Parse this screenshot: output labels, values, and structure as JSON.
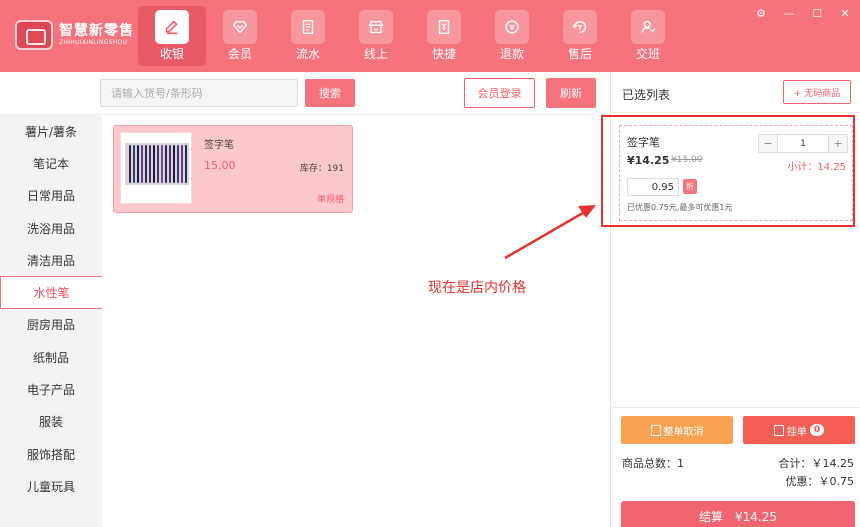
{
  "app": {
    "logo_cn": "智慧新零售",
    "logo_en": "ZHIHUIXINLINGSHOU"
  },
  "nav": [
    {
      "label": "收银",
      "icon": "pencil-icon",
      "active": true
    },
    {
      "label": "会员",
      "icon": "diamond-icon",
      "active": false
    },
    {
      "label": "流水",
      "icon": "document-icon",
      "active": false
    },
    {
      "label": "线上",
      "icon": "store-icon",
      "active": false
    },
    {
      "label": "快捷",
      "icon": "receipt-icon",
      "active": false
    },
    {
      "label": "退款",
      "icon": "refund-icon",
      "active": false
    },
    {
      "label": "售后",
      "icon": "after-sale-icon",
      "active": false
    },
    {
      "label": "交班",
      "icon": "handover-icon",
      "active": false
    }
  ],
  "window_controls": {
    "settings": "⚙",
    "minimize": "—",
    "maximize": "☐",
    "close": "✕"
  },
  "toolbar": {
    "search_placeholder": "请输入货号/条形码",
    "search_label": "搜索",
    "member_login_label": "会员登录",
    "refresh_label": "刷新"
  },
  "categories": [
    {
      "label": "薯片/薯条",
      "active": false
    },
    {
      "label": "笔记本",
      "active": false
    },
    {
      "label": "日常用品",
      "active": false
    },
    {
      "label": "洗浴用品",
      "active": false
    },
    {
      "label": "清洁用品",
      "active": false
    },
    {
      "label": "水性笔",
      "active": true
    },
    {
      "label": "厨房用品",
      "active": false
    },
    {
      "label": "纸制品",
      "active": false
    },
    {
      "label": "电子产品",
      "active": false
    },
    {
      "label": "服装",
      "active": false
    },
    {
      "label": "服饰搭配",
      "active": false
    },
    {
      "label": "儿童玩具",
      "active": false
    }
  ],
  "product": {
    "name": "签字笔",
    "price": "15.00",
    "stock": "库存：191",
    "spec": "单规格"
  },
  "annotation": "现在是店内价格",
  "cart": {
    "title": "已选列表",
    "no_code_label": "+ 无码商品",
    "item": {
      "name": "签字笔",
      "price": "¥14.25",
      "original_price": "¥15.00",
      "quantity": "1",
      "subtotal": "小计：14.25",
      "discount_value": "0.95",
      "discount_tag": "折",
      "discount_note": "已优惠0.75元,最多可优惠1元"
    },
    "cancel_all_label": "整单取消",
    "hold_label": "挂单",
    "hold_count": "0",
    "total_count": "商品总数：1",
    "total_sum": "合计：￥14.25",
    "total_discount": "优惠：￥0.75",
    "checkout_label": "结算　¥14.25"
  },
  "colors": {
    "header": "#f6737d",
    "accent": "#f45e6a",
    "highlight": "#e8312f",
    "cancel": "#f7a250",
    "hold": "#f45e54"
  }
}
